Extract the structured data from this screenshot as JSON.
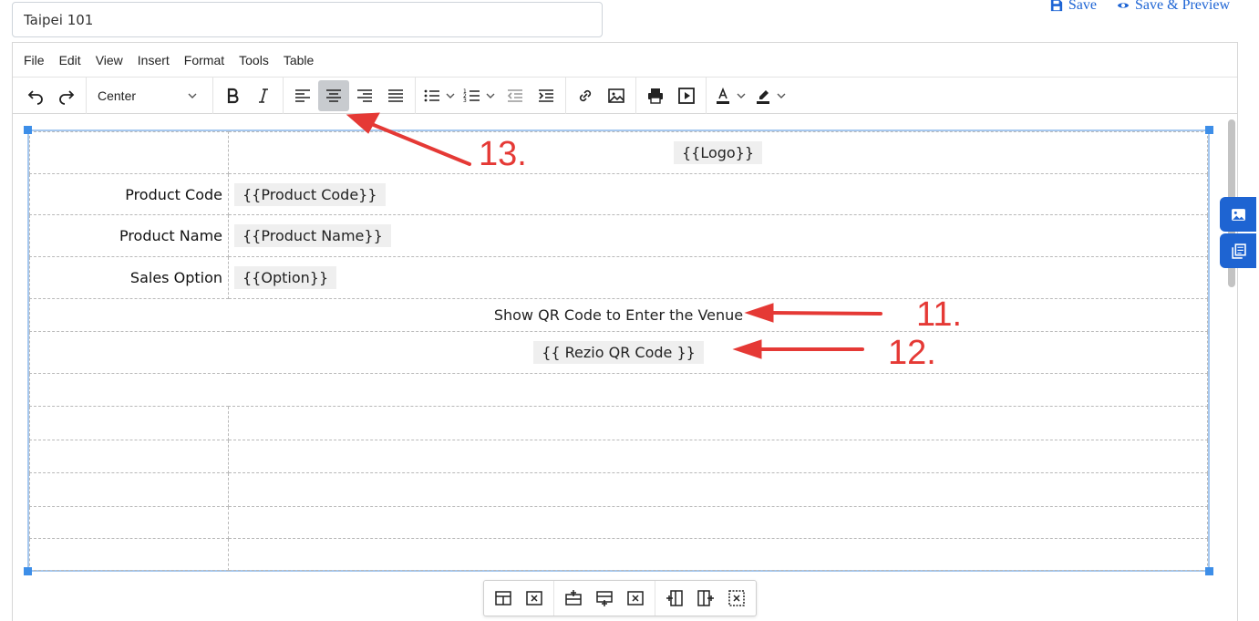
{
  "title_field": {
    "value": "Taipei 101"
  },
  "top_actions": {
    "save": "Save",
    "save_preview": "Save & Preview"
  },
  "menubar": [
    "File",
    "Edit",
    "View",
    "Insert",
    "Format",
    "Tools",
    "Table"
  ],
  "toolbar": {
    "block_format_value": "Center"
  },
  "template_rows": [
    {
      "label": "",
      "token": "{{Logo}}"
    },
    {
      "label": "Product Code",
      "token": "{{Product Code}}"
    },
    {
      "label": "Product Name",
      "token": "{{Product Name}}"
    },
    {
      "label": "Sales Option",
      "token": "{{Option}}"
    },
    {
      "text": "Show QR Code to Enter the Venue"
    },
    {
      "token": "{{ Rezio QR Code }}"
    }
  ],
  "annotations": {
    "a11": "11.",
    "a12": "12.",
    "a13": "13."
  },
  "colors": {
    "accent": "#1e64d2",
    "annotation": "#e53935",
    "selection": "#a6c8ef"
  },
  "icons": [
    "undo-icon",
    "redo-icon",
    "bold-icon",
    "italic-icon",
    "align-left-icon",
    "align-center-icon",
    "align-right-icon",
    "align-justify-icon",
    "bullet-list-icon",
    "numbered-list-icon",
    "outdent-icon",
    "indent-icon",
    "link-icon",
    "image-icon",
    "print-icon",
    "media-icon",
    "text-color-icon",
    "highlight-icon",
    "image-panel-icon",
    "copy-panel-icon"
  ]
}
